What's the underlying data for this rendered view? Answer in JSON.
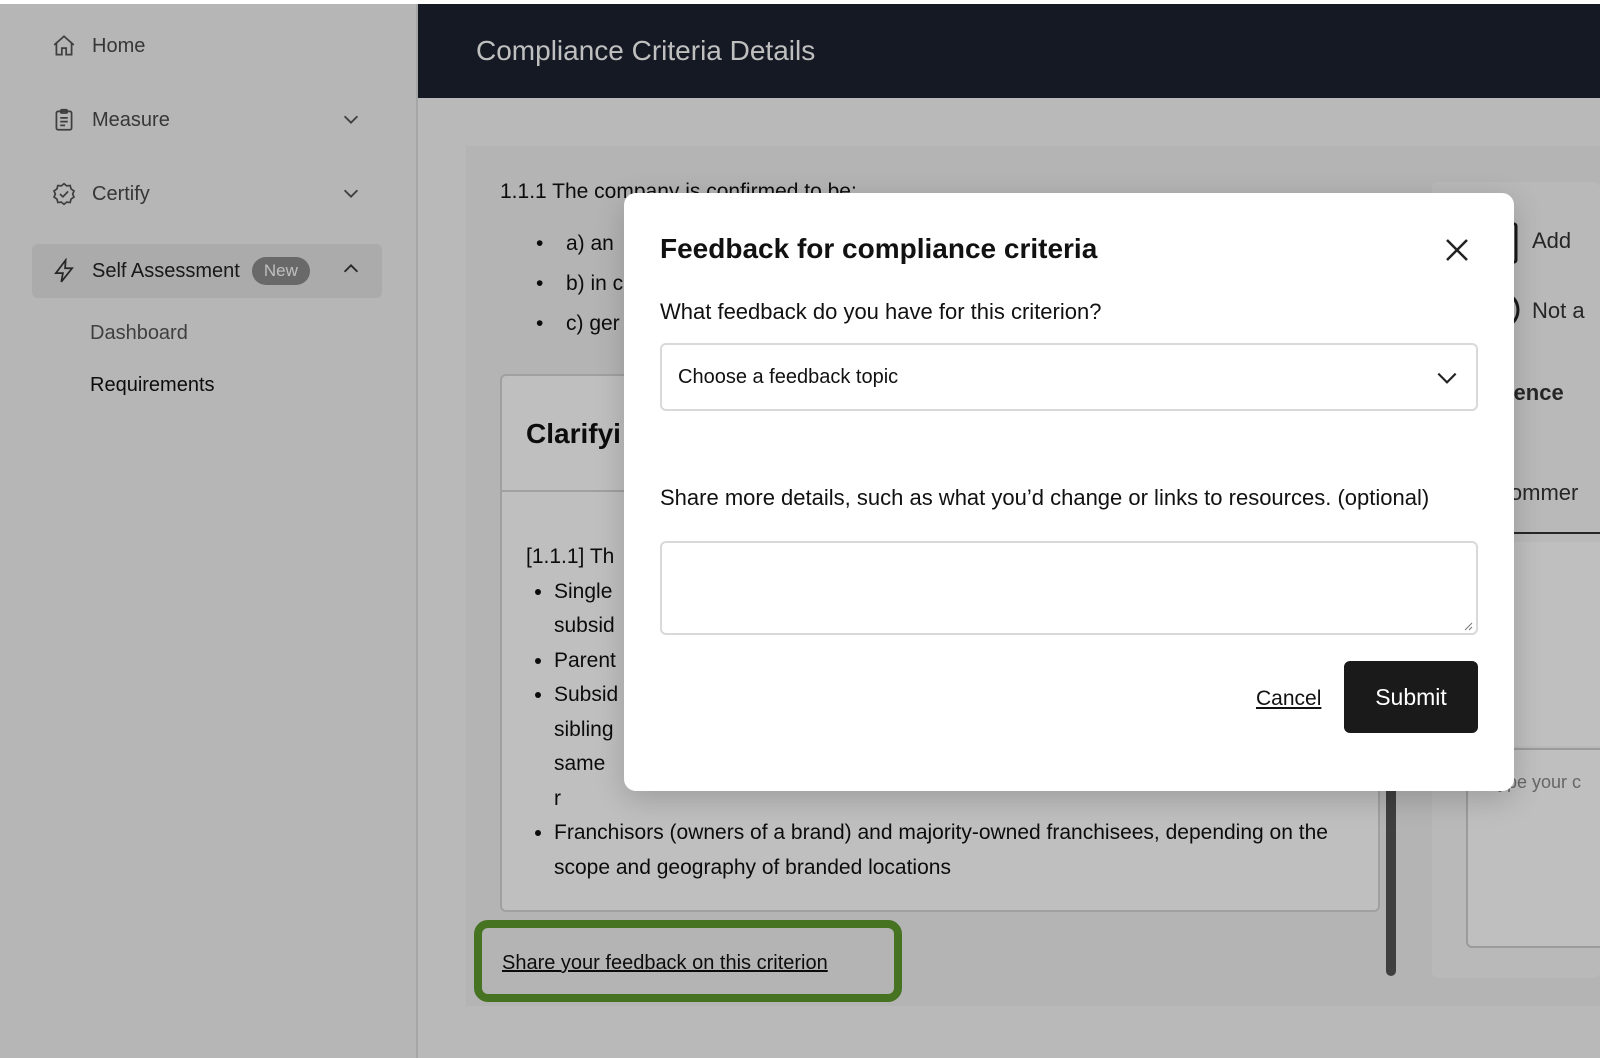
{
  "sidebar": {
    "items": [
      {
        "label": "Home",
        "icon": "home-icon"
      },
      {
        "label": "Measure",
        "icon": "clipboard-icon"
      },
      {
        "label": "Certify",
        "icon": "badge-check-icon"
      },
      {
        "label": "Self Assessment",
        "icon": "lightning-icon",
        "badge": "New"
      }
    ],
    "subitems": [
      {
        "label": "Dashboard"
      },
      {
        "label": "Requirements"
      }
    ]
  },
  "header": {
    "title": "Compliance Criteria Details"
  },
  "criterion": {
    "intro": "1.1.1 The company is confirmed to be:",
    "options": [
      "a) an",
      "b) in c",
      "c) ger"
    ],
    "card_title": "Clarifyi",
    "body_intro": "[1.1.1] Th",
    "bullets": [
      "Single subsid",
      "Parent",
      "Subsid sibling same r",
      "Franchisors (owners of a brand) and majority-owned franchisees, depending on the scope and geography of branded locations"
    ],
    "feedback_link": "Share your feedback on this criterion"
  },
  "right_panel": {
    "add_text": "Add",
    "not_text": "Not a",
    "evidence_text": "idence",
    "comments_text": "Commer",
    "comment_placeholder": "Type your c"
  },
  "modal": {
    "title": "Feedback for compliance criteria",
    "question": "What feedback do you have for this criterion?",
    "select_placeholder": "Choose a feedback topic",
    "details_label": "Share more details, such as what you’d change or links to resources. (optional)",
    "details_value": "",
    "cancel_label": "Cancel",
    "submit_label": "Submit"
  },
  "colors": {
    "header_bg": "#1b2230",
    "highlight": "#5c9a2e",
    "submit_bg": "#1a1a1a"
  }
}
